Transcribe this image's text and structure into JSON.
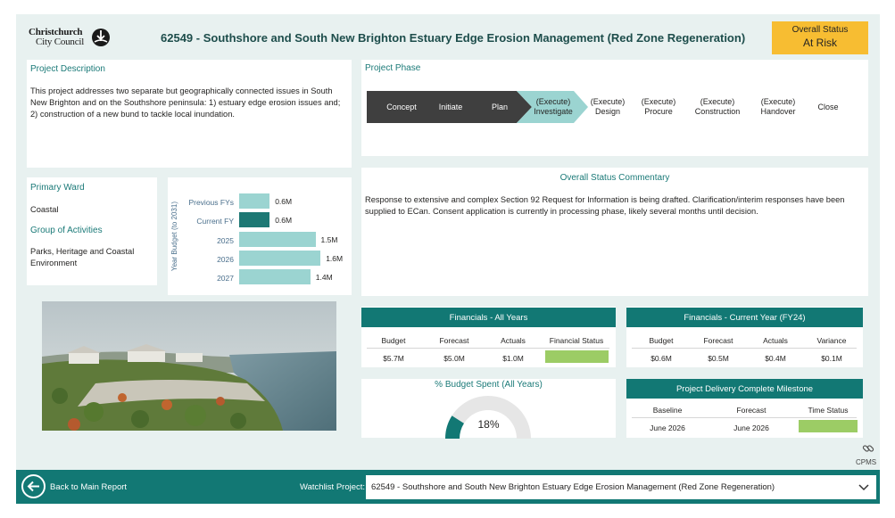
{
  "header": {
    "logo_line1": "Christchurch",
    "logo_line2": "City Council",
    "title": "62549 - Southshore and South New Brighton Estuary Edge Erosion Management (Red Zone Regeneration)",
    "status_label": "Overall Status",
    "status_value": "At Risk",
    "status_color": "#f7bd32"
  },
  "description": {
    "title": "Project Description",
    "text": "This project addresses two separate but geographically connected issues in South New Brighton and on the Southshore peninsula: 1) estuary edge erosion issues and; 2) construction of a new bund to tackle local inundation."
  },
  "phase": {
    "title": "Project Phase",
    "steps": [
      "Concept",
      "Initiate",
      "Plan",
      "(Execute) Investigate",
      "(Execute) Design",
      "(Execute) Procure",
      "(Execute) Construction",
      "(Execute) Handover",
      "Close"
    ],
    "current": "(Execute) Investigate"
  },
  "ward": {
    "ward_title": "Primary Ward",
    "ward_value": "Coastal",
    "group_title": "Group of Activities",
    "group_value": "Parks, Heritage and Coastal Environment"
  },
  "chart_data": {
    "type": "bar",
    "orientation": "horizontal",
    "ylabel": "Year Budget (to 2031)",
    "categories": [
      "Previous FYs",
      "Current FY",
      "2025",
      "2026",
      "2027"
    ],
    "values": [
      0.6,
      0.6,
      1.5,
      1.6,
      1.4
    ],
    "labels": [
      "0.6M",
      "0.6M",
      "1.5M",
      "1.6M",
      "1.4M"
    ],
    "highlight": "Current FY",
    "colors": {
      "bar": "#9bd4d1",
      "highlight": "#1d7874"
    }
  },
  "commentary": {
    "title": "Overall Status Commentary",
    "text": "Response to extensive and complex Section 92 Request for Information is being drafted. Clarification/interim responses have been supplied to ECan. Consent application is currently in processing phase, likely several months until decision."
  },
  "fin_all": {
    "title": "Financials - All Years",
    "headers": [
      "Budget",
      "Forecast",
      "Actuals",
      "Financial Status"
    ],
    "values": [
      "$5.7M",
      "$5.0M",
      "$1.0M",
      ""
    ],
    "status_color": "#9ccc65"
  },
  "fin_cur": {
    "title": "Financials - Current Year (FY24)",
    "headers": [
      "Budget",
      "Forecast",
      "Actuals",
      "Variance"
    ],
    "values": [
      "$0.6M",
      "$0.5M",
      "$0.4M",
      "$0.1M"
    ]
  },
  "gauge": {
    "title": "% Budget Spent (All Years)",
    "value": "18%",
    "fraction": 0.18
  },
  "milestone": {
    "title": "Project Delivery Complete Milestone",
    "headers": [
      "Baseline",
      "Forecast",
      "Time Status"
    ],
    "values": [
      "June 2026",
      "June 2026",
      ""
    ],
    "status_color": "#9ccc65"
  },
  "cpms_label": "CPMS",
  "footer": {
    "back_label": "Back to Main Report",
    "watchlist_label": "Watchlist Project:",
    "watchlist_value": "62549 - Southshore and South New Brighton Estuary Edge Erosion Management (Red Zone Regeneration)"
  },
  "colors": {
    "teal": "#127874",
    "background": "#e8f1f0"
  }
}
